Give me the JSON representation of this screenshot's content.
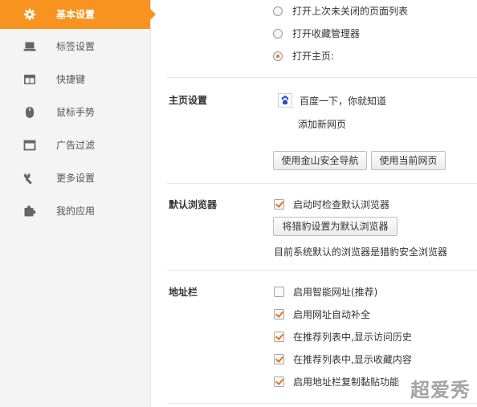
{
  "colors": {
    "accent": "#f7931e",
    "check": "#e8731e"
  },
  "sidebar": {
    "items": [
      {
        "label": "基本设置",
        "icon": "gear-icon",
        "active": true
      },
      {
        "label": "标签设置",
        "icon": "laptop-icon"
      },
      {
        "label": "快捷键",
        "icon": "window-icon"
      },
      {
        "label": "鼠标手势",
        "icon": "mouse-icon"
      },
      {
        "label": "广告过滤",
        "icon": "browser-window-icon"
      },
      {
        "label": "更多设置",
        "icon": "wrench-icon"
      },
      {
        "label": "我的应用",
        "icon": "puzzle-icon"
      }
    ]
  },
  "startup": {
    "options": [
      {
        "label": "打开上次未关闭的页面列表",
        "selected": false
      },
      {
        "label": "打开收藏管理器",
        "selected": false
      },
      {
        "label": "打开主页:",
        "selected": true
      }
    ]
  },
  "homepage": {
    "title": "主页设置",
    "entry": "百度一下，你就知道",
    "icon": "paw-icon",
    "add_link": "添加新网页",
    "btn_kingsoft": "使用金山安全导航",
    "btn_current": "使用当前网页"
  },
  "default_browser": {
    "title": "默认浏览器",
    "check_label": "启动时检查默认浏览器",
    "check_on": true,
    "set_button": "将猎豹设置为默认浏览器",
    "status": "目前系统默认的浏览器是猎豹安全浏览器"
  },
  "address_bar": {
    "title": "地址栏",
    "options": [
      {
        "label": "启用智能网址(推荐)",
        "checked": false
      },
      {
        "label": "启用网址自动补全",
        "checked": true
      },
      {
        "label": "在推荐列表中,显示访问历史",
        "checked": true
      },
      {
        "label": "在推荐列表中,显示收藏内容",
        "checked": true
      },
      {
        "label": "启用地址栏复制黏贴功能",
        "checked": true
      }
    ]
  },
  "watermark": "超爱秀"
}
